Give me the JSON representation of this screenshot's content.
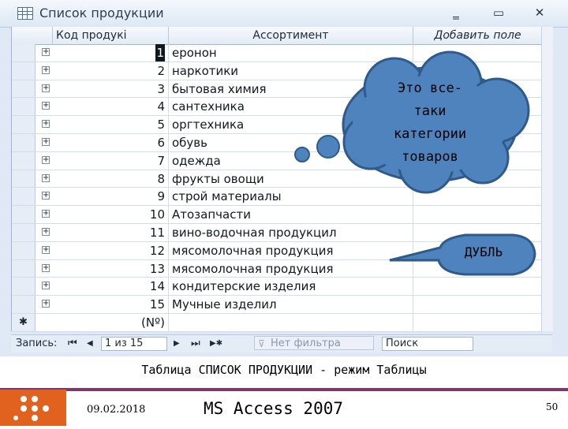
{
  "window": {
    "title": "Список продукции",
    "minimize": "‗",
    "restore": "▭",
    "close": "✕"
  },
  "table": {
    "columns": [
      "Код продукі",
      "Ассортимент",
      "Добавить поле"
    ],
    "rows": [
      {
        "id": "1",
        "name": "еронон"
      },
      {
        "id": "2",
        "name": "наркотики"
      },
      {
        "id": "3",
        "name": "бытовая химия"
      },
      {
        "id": "4",
        "name": "сантехника"
      },
      {
        "id": "5",
        "name": "оргтехника"
      },
      {
        "id": "6",
        "name": "обувь"
      },
      {
        "id": "7",
        "name": "одежда"
      },
      {
        "id": "8",
        "name": "фрукты овощи"
      },
      {
        "id": "9",
        "name": "строй материалы"
      },
      {
        "id": "10",
        "name": "Атозапчасти"
      },
      {
        "id": "11",
        "name": "вино-водочная продукцил"
      },
      {
        "id": "12",
        "name": "мясомолочная продукция"
      },
      {
        "id": "13",
        "name": "мясомолочная продукция"
      },
      {
        "id": "14",
        "name": "кондитерские изделия"
      },
      {
        "id": "15",
        "name": "Мучные изделил"
      }
    ],
    "new_row_marker": "✱",
    "new_row_id": "(Nº)"
  },
  "navigation": {
    "record_label": "Запись:",
    "first": "⏮",
    "prev": "◀",
    "position": "1 из 15",
    "next": "▶",
    "last": "⏭",
    "new": "▶✱",
    "filter": "Нет фильтра",
    "search": "Поиск"
  },
  "callouts": {
    "cloud": [
      "Это все-",
      "таки",
      "категории",
      "товаров"
    ],
    "bubble": "ДУБЛЬ"
  },
  "caption": "Таблица СПИСОК ПРОДУКЦИИ - режим Таблицы",
  "footer": {
    "date": "09.02.2018",
    "title": "MS Access 2007",
    "page": "50"
  },
  "colors": {
    "callout_fill": "#4f83be",
    "callout_stroke": "#2e5a8c",
    "footer_accent": "#7c3a6c",
    "logo": "#e0621e"
  }
}
